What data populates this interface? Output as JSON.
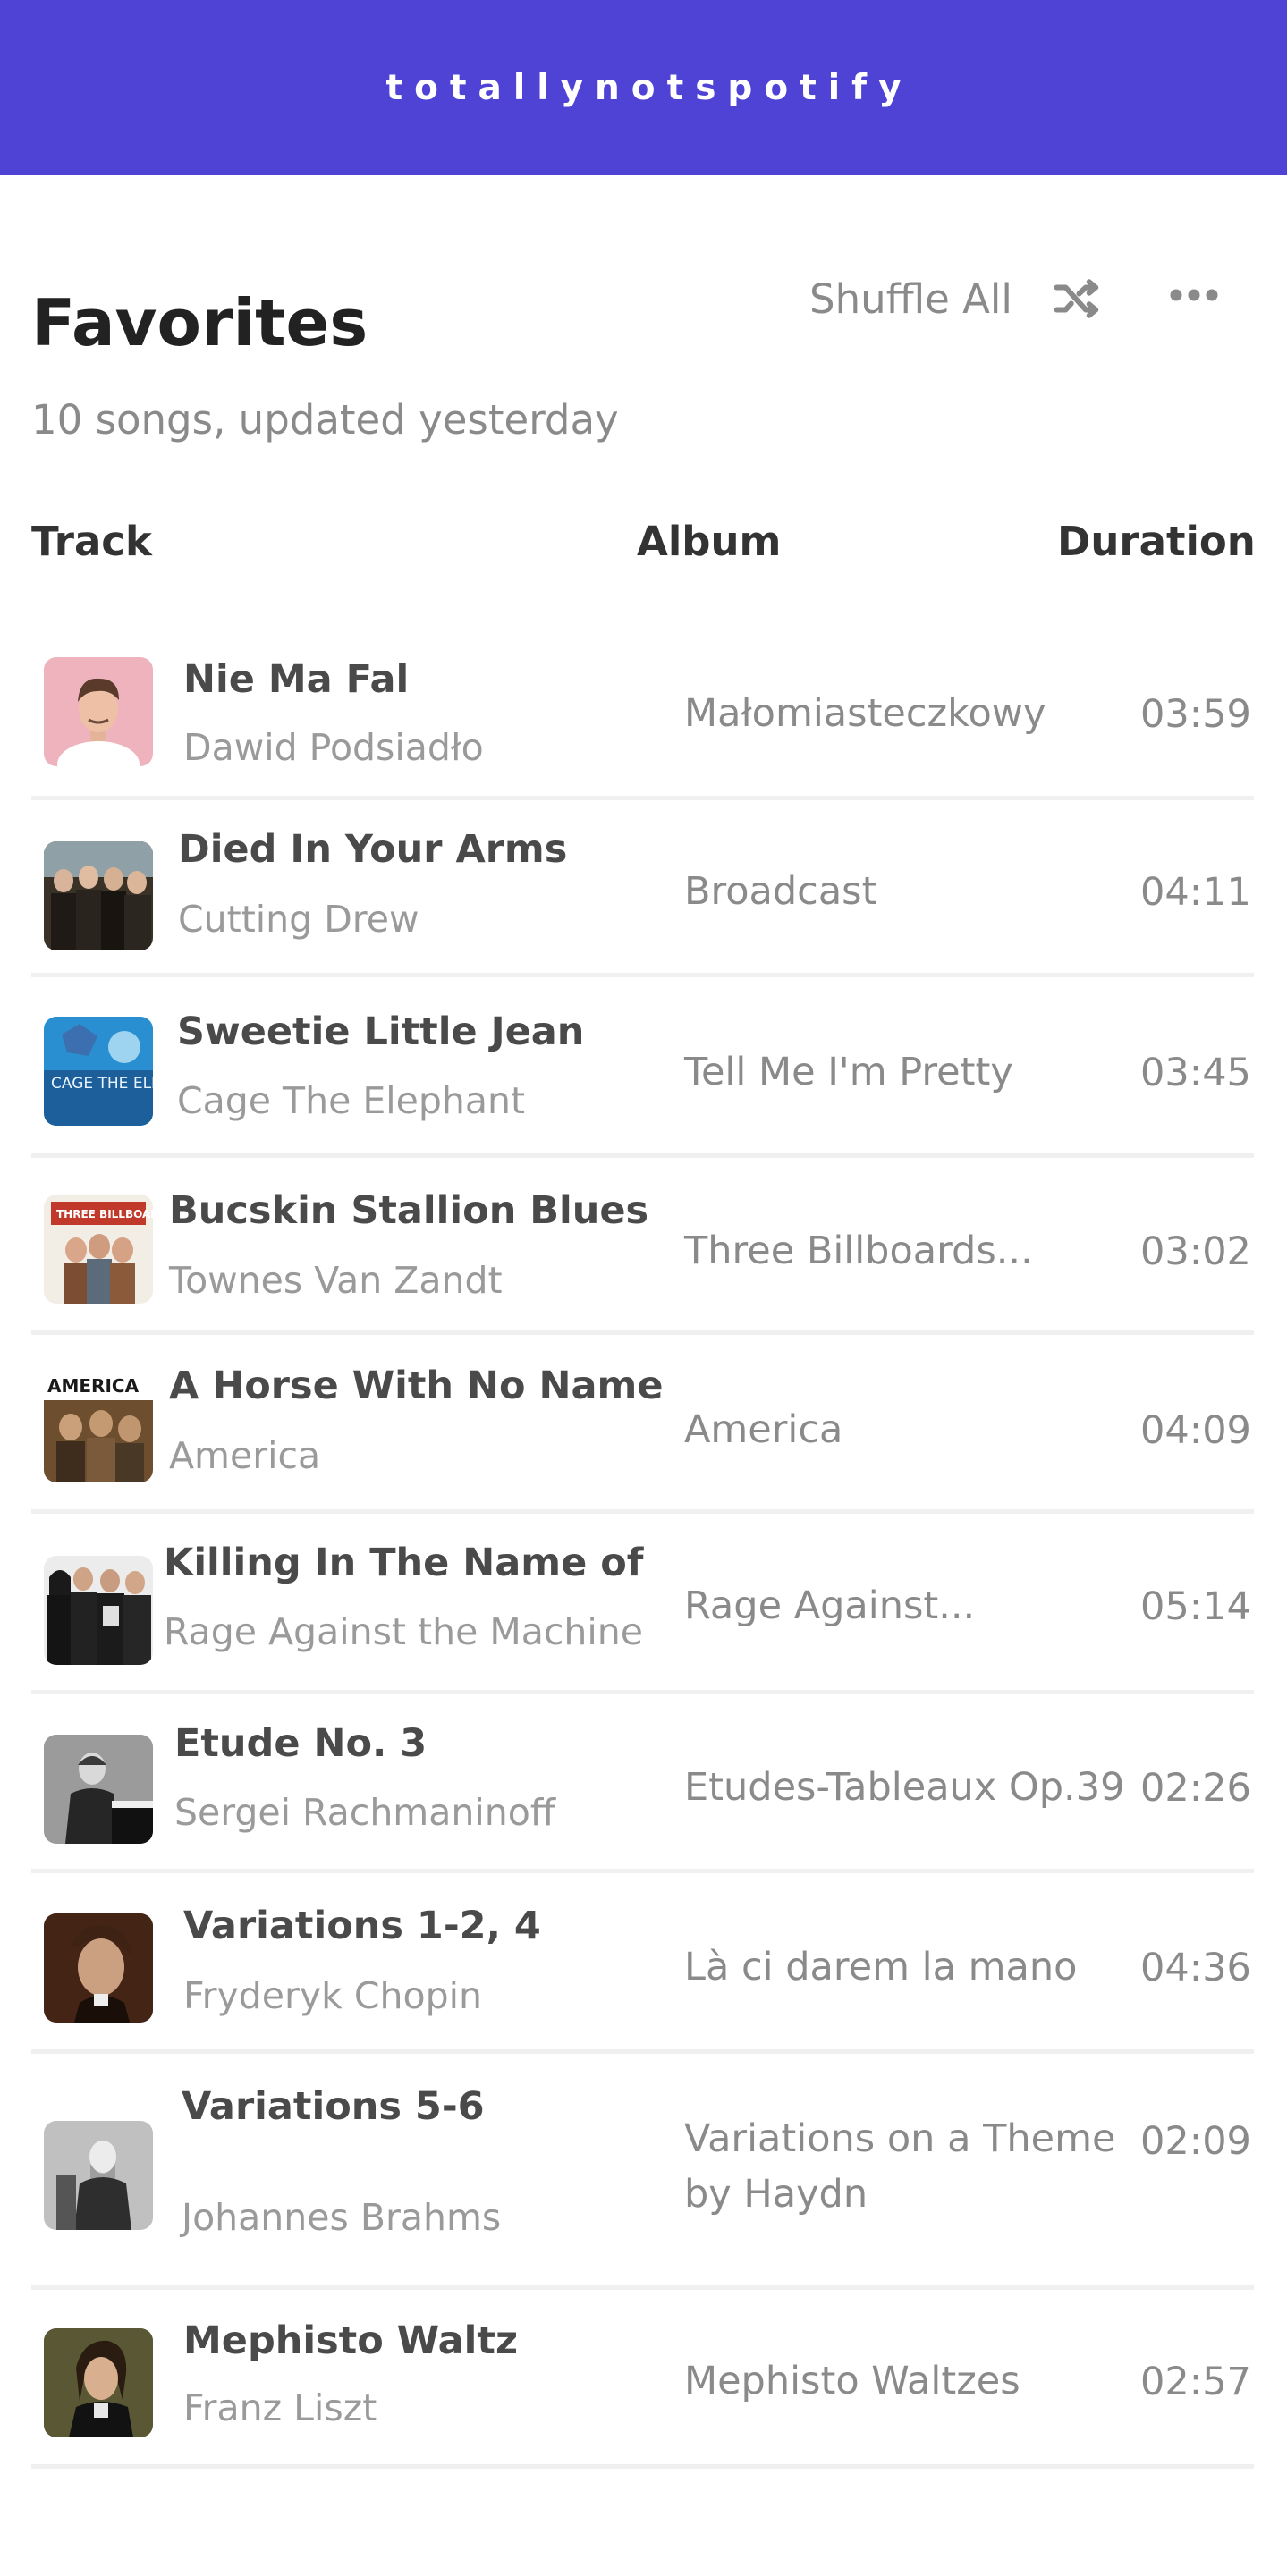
{
  "app": {
    "brand": "totallynotspotify",
    "accent": "#4f43d6"
  },
  "playlist": {
    "title": "Favorites",
    "subtitle": "10 songs, updated yesterday",
    "shuffle_label": "Shuffle All"
  },
  "columns": {
    "track": "Track",
    "album": "Album",
    "duration": "Duration"
  },
  "tracks": [
    {
      "title": "Nie Ma Fal",
      "artist": "Dawid Podsiadło",
      "album": "Małomiasteczkowy",
      "duration": "03:59"
    },
    {
      "title": "Died In Your Arms",
      "artist": "Cutting Drew",
      "album": "Broadcast",
      "duration": "04:11"
    },
    {
      "title": "Sweetie Little Jean",
      "artist": "Cage The Elephant",
      "album": "Tell Me I'm Pretty",
      "duration": "03:45"
    },
    {
      "title": "Bucskin Stallion Blues",
      "artist": "Townes Van Zandt",
      "album": "Three Billboards...",
      "duration": "03:02"
    },
    {
      "title": "A Horse With No Name",
      "artist": "America",
      "album": "America",
      "duration": "04:09"
    },
    {
      "title": "Killing In The Name of",
      "artist": "Rage Against the Machine",
      "album": "Rage Against...",
      "duration": "05:14"
    },
    {
      "title": "Etude No. 3",
      "artist": "Sergei Rachmaninoff",
      "album": "Etudes-Tableaux Op.39",
      "duration": "02:26"
    },
    {
      "title": "Variations 1-2, 4",
      "artist": "Fryderyk Chopin",
      "album": "Là ci darem la mano",
      "duration": "04:36"
    },
    {
      "title": "Variations 5-6",
      "artist": "Johannes Brahms",
      "album": "Variations on a Theme by Haydn",
      "duration": "02:09"
    },
    {
      "title": "Mephisto Waltz",
      "artist": "Franz Liszt",
      "album": "Mephisto Waltzes",
      "duration": "02:57"
    }
  ],
  "covers": {
    "cover_3_text": "CAGE THE ELEPHANT",
    "cover_4_text": "THREE BILLBOARDS",
    "cover_5_text": "AMERICA"
  }
}
